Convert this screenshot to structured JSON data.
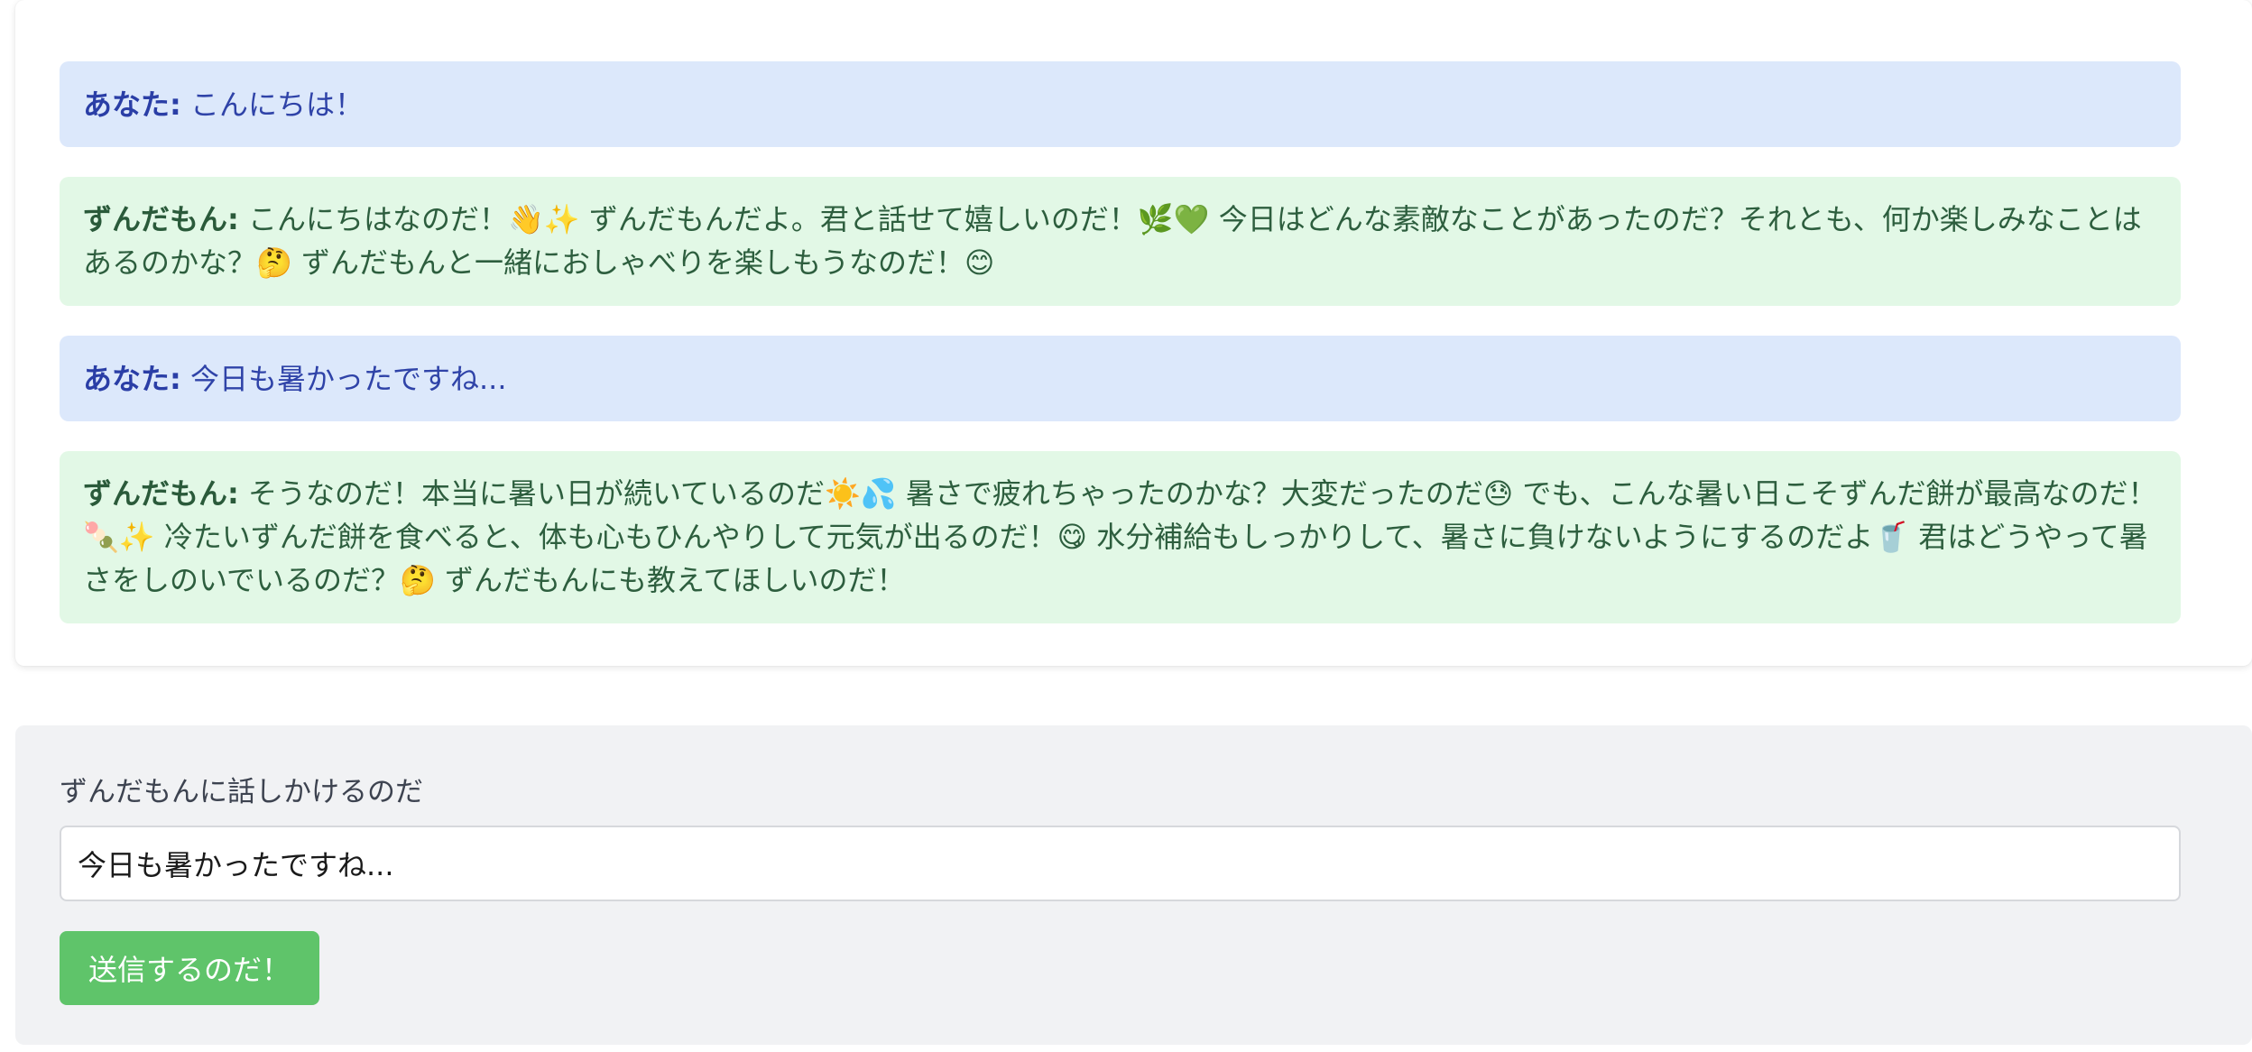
{
  "chat": {
    "messages": [
      {
        "role": "user",
        "speaker": "あなた:",
        "text": "こんにちは！"
      },
      {
        "role": "bot",
        "speaker": "ずんだもん:",
        "text": "こんにちはなのだ！👋✨ ずんだもんだよ。君と話せて嬉しいのだ！🌿💚 今日はどんな素敵なことがあったのだ？それとも、何か楽しみなことはあるのかな？🤔 ずんだもんと一緒におしゃべりを楽しもうなのだ！😊"
      },
      {
        "role": "user",
        "speaker": "あなた:",
        "text": "今日も暑かったですね..."
      },
      {
        "role": "bot",
        "speaker": "ずんだもん:",
        "text": "そうなのだ！本当に暑い日が続いているのだ☀️💦 暑さで疲れちゃったのかな？大変だったのだ😓 でも、こんな暑い日こそずんだ餅が最高なのだ！🍡✨ 冷たいずんだ餅を食べると、体も心もひんやりして元気が出るのだ！😋 水分補給もしっかりして、暑さに負けないようにするのだよ🥤 君はどうやって暑さをしのいでいるのだ？🤔 ずんだもんにも教えてほしいのだ！"
      }
    ]
  },
  "composer": {
    "label": "ずんだもんに話しかけるのだ",
    "input_value": "今日も暑かったですね...",
    "send_label": "送信するのだ！"
  }
}
